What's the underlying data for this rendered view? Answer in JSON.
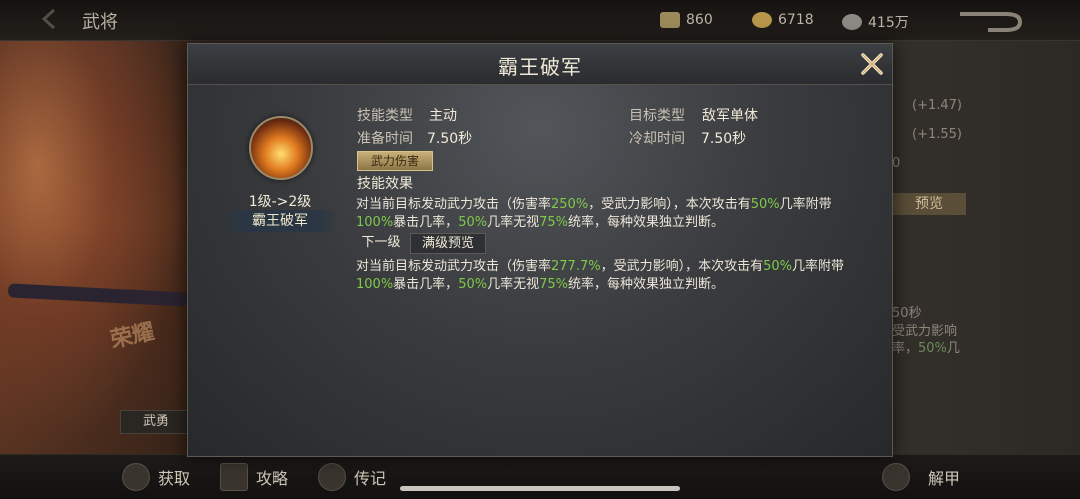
{
  "topbar": {
    "title": "武将",
    "resources": [
      {
        "icon": "jade-icon",
        "value": "860"
      },
      {
        "icon": "gold-coin-icon",
        "value": "6718"
      },
      {
        "icon": "silver-coin-icon",
        "value": "415万"
      }
    ]
  },
  "bottombar": {
    "items": [
      {
        "icon": "obtain-icon",
        "label": "获取"
      },
      {
        "icon": "strategy-book-icon",
        "label": "攻略"
      },
      {
        "icon": "biography-icon",
        "label": "传记"
      },
      {
        "icon": "armor-icon",
        "label": "解甲"
      }
    ]
  },
  "background": {
    "badge": "武勇",
    "stat_bonus_1": "(+1.47)",
    "stat_bonus_2": "(+1.55)",
    "stat_fragment": "0",
    "preview_label": "预览",
    "side_time": "50秒",
    "side_text_1": "受武力影响",
    "side_text_2_prefix": "率，",
    "side_text_2_pct": "50%",
    "side_text_2_suffix": "几"
  },
  "modal": {
    "title": "霸王破军",
    "close_icon": "close-x-icon",
    "skill": {
      "level_text": "1级->2级",
      "name": "霸王破军"
    },
    "info": {
      "type_label": "技能类型",
      "type_value": "主动",
      "target_label": "目标类型",
      "target_value": "敌军单体",
      "prep_label": "准备时间",
      "prep_value": "7.50秒",
      "cooldown_label": "冷却时间",
      "cooldown_value": "7.50秒",
      "damage_tag": "武力伤害",
      "effect_label": "技能效果"
    },
    "current_effect": {
      "p1": "对当前目标发动武力攻击（伤害率",
      "v1": "250%",
      "p2": "，受武力影响），本次攻击有",
      "v2": "50%",
      "p3": "几率附带",
      "v3": "100%",
      "p4": "暴击几率，",
      "v4": "50%",
      "p5": "几率无视",
      "v5": "75%",
      "p6": "统率，每种效果独立判断。"
    },
    "tabs": {
      "next_level": "下一级",
      "max_preview": "满级预览"
    },
    "next_effect": {
      "p1": "对当前目标发动武力攻击（伤害率",
      "v1": "277.7%",
      "p2": "，受武力影响），本次攻击有",
      "v2": "50%",
      "p3": "几率附带",
      "v3": "100%",
      "p4": "暴击几率，",
      "v4": "50%",
      "p5": "几率无视",
      "v5": "75%",
      "p6": "统率，每种效果独立判断。"
    }
  }
}
